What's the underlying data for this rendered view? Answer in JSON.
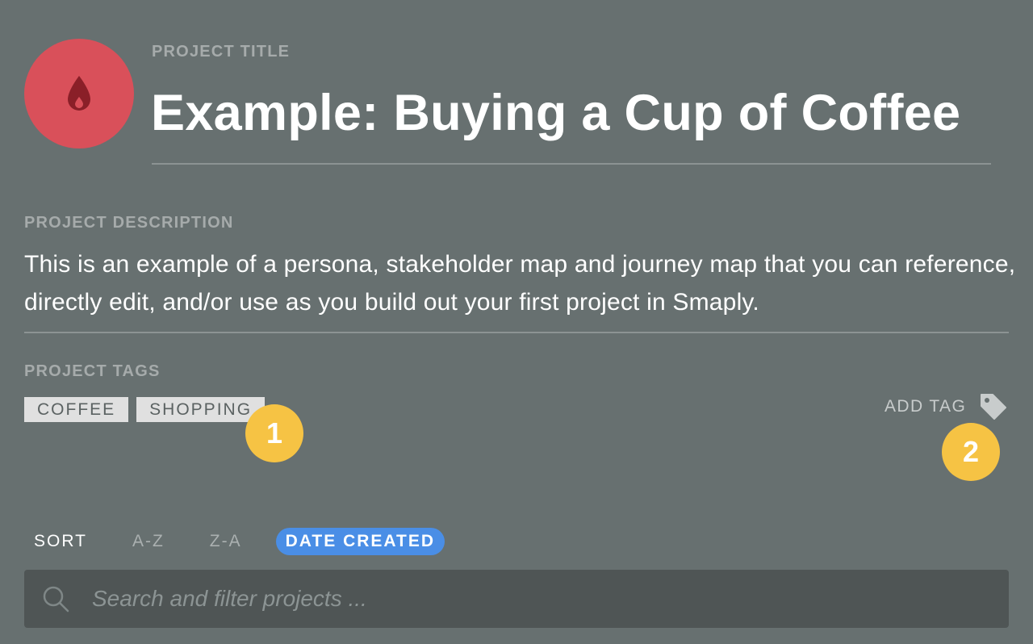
{
  "project": {
    "title_label": "PROJECT TITLE",
    "title": "Example: Buying a Cup of Coffee",
    "avatar_icon": "drop-icon",
    "avatar_color": "#d9505a"
  },
  "description": {
    "label": "PROJECT DESCRIPTION",
    "text": "This is an example of a persona, stakeholder map and journey map that you can reference, directly edit, and/or use as you build out your first project in Smaply."
  },
  "tags": {
    "label": "PROJECT TAGS",
    "items": [
      "COFFEE",
      "SHOPPING"
    ],
    "add_label": "ADD TAG",
    "add_icon": "tag-icon"
  },
  "badges": [
    "1",
    "2"
  ],
  "sort": {
    "label": "SORT",
    "options": [
      "A-Z",
      "Z-A",
      "DATE CREATED"
    ],
    "active": "DATE CREATED",
    "active_color": "#4a8ee6"
  },
  "search": {
    "placeholder": "Search and filter projects ...",
    "value": ""
  }
}
